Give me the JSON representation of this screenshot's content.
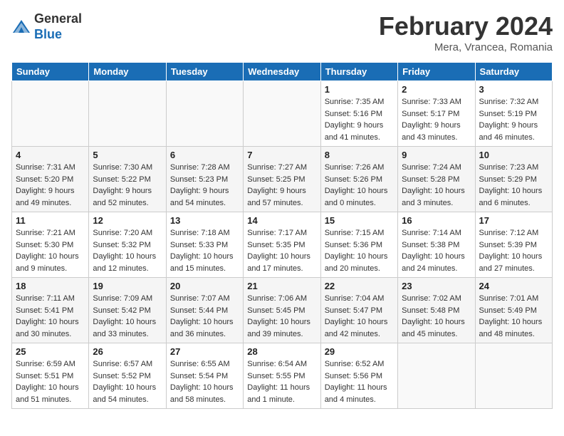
{
  "header": {
    "logo_general": "General",
    "logo_blue": "Blue",
    "title": "February 2024",
    "subtitle": "Mera, Vrancea, Romania"
  },
  "columns": [
    "Sunday",
    "Monday",
    "Tuesday",
    "Wednesday",
    "Thursday",
    "Friday",
    "Saturday"
  ],
  "weeks": [
    [
      {
        "day": "",
        "info": ""
      },
      {
        "day": "",
        "info": ""
      },
      {
        "day": "",
        "info": ""
      },
      {
        "day": "",
        "info": ""
      },
      {
        "day": "1",
        "info": "Sunrise: 7:35 AM\nSunset: 5:16 PM\nDaylight: 9 hours and 41 minutes."
      },
      {
        "day": "2",
        "info": "Sunrise: 7:33 AM\nSunset: 5:17 PM\nDaylight: 9 hours and 43 minutes."
      },
      {
        "day": "3",
        "info": "Sunrise: 7:32 AM\nSunset: 5:19 PM\nDaylight: 9 hours and 46 minutes."
      }
    ],
    [
      {
        "day": "4",
        "info": "Sunrise: 7:31 AM\nSunset: 5:20 PM\nDaylight: 9 hours and 49 minutes."
      },
      {
        "day": "5",
        "info": "Sunrise: 7:30 AM\nSunset: 5:22 PM\nDaylight: 9 hours and 52 minutes."
      },
      {
        "day": "6",
        "info": "Sunrise: 7:28 AM\nSunset: 5:23 PM\nDaylight: 9 hours and 54 minutes."
      },
      {
        "day": "7",
        "info": "Sunrise: 7:27 AM\nSunset: 5:25 PM\nDaylight: 9 hours and 57 minutes."
      },
      {
        "day": "8",
        "info": "Sunrise: 7:26 AM\nSunset: 5:26 PM\nDaylight: 10 hours and 0 minutes."
      },
      {
        "day": "9",
        "info": "Sunrise: 7:24 AM\nSunset: 5:28 PM\nDaylight: 10 hours and 3 minutes."
      },
      {
        "day": "10",
        "info": "Sunrise: 7:23 AM\nSunset: 5:29 PM\nDaylight: 10 hours and 6 minutes."
      }
    ],
    [
      {
        "day": "11",
        "info": "Sunrise: 7:21 AM\nSunset: 5:30 PM\nDaylight: 10 hours and 9 minutes."
      },
      {
        "day": "12",
        "info": "Sunrise: 7:20 AM\nSunset: 5:32 PM\nDaylight: 10 hours and 12 minutes."
      },
      {
        "day": "13",
        "info": "Sunrise: 7:18 AM\nSunset: 5:33 PM\nDaylight: 10 hours and 15 minutes."
      },
      {
        "day": "14",
        "info": "Sunrise: 7:17 AM\nSunset: 5:35 PM\nDaylight: 10 hours and 17 minutes."
      },
      {
        "day": "15",
        "info": "Sunrise: 7:15 AM\nSunset: 5:36 PM\nDaylight: 10 hours and 20 minutes."
      },
      {
        "day": "16",
        "info": "Sunrise: 7:14 AM\nSunset: 5:38 PM\nDaylight: 10 hours and 24 minutes."
      },
      {
        "day": "17",
        "info": "Sunrise: 7:12 AM\nSunset: 5:39 PM\nDaylight: 10 hours and 27 minutes."
      }
    ],
    [
      {
        "day": "18",
        "info": "Sunrise: 7:11 AM\nSunset: 5:41 PM\nDaylight: 10 hours and 30 minutes."
      },
      {
        "day": "19",
        "info": "Sunrise: 7:09 AM\nSunset: 5:42 PM\nDaylight: 10 hours and 33 minutes."
      },
      {
        "day": "20",
        "info": "Sunrise: 7:07 AM\nSunset: 5:44 PM\nDaylight: 10 hours and 36 minutes."
      },
      {
        "day": "21",
        "info": "Sunrise: 7:06 AM\nSunset: 5:45 PM\nDaylight: 10 hours and 39 minutes."
      },
      {
        "day": "22",
        "info": "Sunrise: 7:04 AM\nSunset: 5:47 PM\nDaylight: 10 hours and 42 minutes."
      },
      {
        "day": "23",
        "info": "Sunrise: 7:02 AM\nSunset: 5:48 PM\nDaylight: 10 hours and 45 minutes."
      },
      {
        "day": "24",
        "info": "Sunrise: 7:01 AM\nSunset: 5:49 PM\nDaylight: 10 hours and 48 minutes."
      }
    ],
    [
      {
        "day": "25",
        "info": "Sunrise: 6:59 AM\nSunset: 5:51 PM\nDaylight: 10 hours and 51 minutes."
      },
      {
        "day": "26",
        "info": "Sunrise: 6:57 AM\nSunset: 5:52 PM\nDaylight: 10 hours and 54 minutes."
      },
      {
        "day": "27",
        "info": "Sunrise: 6:55 AM\nSunset: 5:54 PM\nDaylight: 10 hours and 58 minutes."
      },
      {
        "day": "28",
        "info": "Sunrise: 6:54 AM\nSunset: 5:55 PM\nDaylight: 11 hours and 1 minute."
      },
      {
        "day": "29",
        "info": "Sunrise: 6:52 AM\nSunset: 5:56 PM\nDaylight: 11 hours and 4 minutes."
      },
      {
        "day": "",
        "info": ""
      },
      {
        "day": "",
        "info": ""
      }
    ]
  ]
}
